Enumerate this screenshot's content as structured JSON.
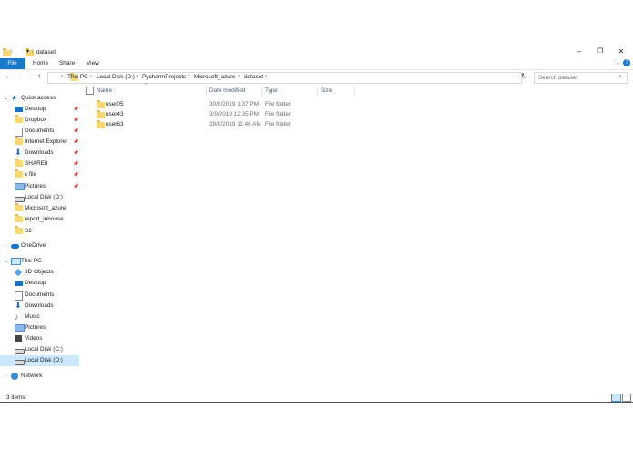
{
  "window": {
    "title": "dataset",
    "minimize_icon": "minimize-icon",
    "restore_icon": "restore-icon",
    "close_icon": "close-icon"
  },
  "ribbon": {
    "tabs": [
      "File",
      "Home",
      "Share",
      "View"
    ]
  },
  "address": {
    "crumbs": [
      "This PC",
      "Local Disk (D:)",
      "PycharmProjects",
      "Microsoft_azure",
      "dataset"
    ],
    "search_placeholder": "Search dataset"
  },
  "nav": {
    "quick_access": "Quick access",
    "quick_items": [
      {
        "label": "Desktop",
        "icon": "desktop-icon",
        "pinned": true
      },
      {
        "label": "Dropbox",
        "icon": "folder-icon",
        "pinned": true
      },
      {
        "label": "Documents",
        "icon": "documents-icon",
        "pinned": true
      },
      {
        "label": "Internet Explorer",
        "icon": "folder-icon",
        "pinned": true
      },
      {
        "label": "Downloads",
        "icon": "downloads-icon",
        "pinned": true
      },
      {
        "label": "SHAREit",
        "icon": "folder-icon",
        "pinned": true
      },
      {
        "label": "c file",
        "icon": "folder-icon",
        "pinned": true
      },
      {
        "label": "Pictures",
        "icon": "pictures-icon",
        "pinned": true
      },
      {
        "label": "Local Disk (D:)",
        "icon": "drive-icon",
        "pinned": false
      },
      {
        "label": "Microsoft_azure",
        "icon": "folder-icon",
        "pinned": false
      },
      {
        "label": "report_inhouse",
        "icon": "folder-icon",
        "pinned": false
      },
      {
        "label": "S2",
        "icon": "folder-icon",
        "pinned": false
      }
    ],
    "onedrive": "OneDrive",
    "this_pc": "This PC",
    "pc_items": [
      {
        "label": "3D Objects",
        "icon": "3d-objects-icon"
      },
      {
        "label": "Desktop",
        "icon": "desktop-icon"
      },
      {
        "label": "Documents",
        "icon": "documents-icon"
      },
      {
        "label": "Downloads",
        "icon": "downloads-icon"
      },
      {
        "label": "Music",
        "icon": "music-icon"
      },
      {
        "label": "Pictures",
        "icon": "pictures-icon"
      },
      {
        "label": "Videos",
        "icon": "videos-icon"
      },
      {
        "label": "Local Disk (C:)",
        "icon": "drive-icon"
      },
      {
        "label": "Local Disk (D:)",
        "icon": "drive-icon"
      }
    ],
    "network": "Network",
    "selected_color": "#cce8ff"
  },
  "columns": {
    "name": "Name",
    "date": "Date modified",
    "type": "Type",
    "size": "Size"
  },
  "files": [
    {
      "name": "user05",
      "date": "30/8/2019 1:37 PM",
      "type": "File folder",
      "size": ""
    },
    {
      "name": "user43",
      "date": "3/9/2019 12:35 PM",
      "type": "File folder",
      "size": ""
    },
    {
      "name": "user63",
      "date": "28/8/2019 11:46 AM",
      "type": "File folder",
      "size": ""
    }
  ],
  "status": {
    "count": "3 items"
  }
}
